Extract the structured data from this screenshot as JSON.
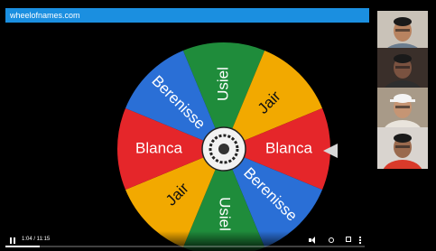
{
  "app": {
    "title": "wheelofnames.com"
  },
  "wheel": {
    "segments": [
      {
        "label": "Usiel",
        "color": "#1f8c3b"
      },
      {
        "label": "Jair",
        "color": "#f2a900"
      },
      {
        "label": "Blanca",
        "color": "#e5262a"
      },
      {
        "label": "Berenisse",
        "color": "#2a6fd6"
      },
      {
        "label": "Usiel",
        "color": "#1f8c3b"
      },
      {
        "label": "Jair",
        "color": "#f2a900"
      },
      {
        "label": "Blanca",
        "color": "#e5262a"
      },
      {
        "label": "Berenisse",
        "color": "#2a6fd6"
      }
    ]
  },
  "player": {
    "time": "1:04 / 11:15",
    "progress": 0.095
  },
  "participants": [
    {
      "shirt": "#6b7d8f",
      "skin": "#b88360",
      "bg": "#c9c2b8",
      "hat": false
    },
    {
      "shirt": "#2e2e2e",
      "skin": "#7a5240",
      "bg": "#3a2f2a",
      "hat": false
    },
    {
      "shirt": "#e9e4dc",
      "skin": "#c59574",
      "bg": "#a89a88",
      "hat": true
    },
    {
      "shirt": "#d93a2a",
      "skin": "#9a6a4e",
      "bg": "#d9d4cf",
      "hat": false
    }
  ]
}
